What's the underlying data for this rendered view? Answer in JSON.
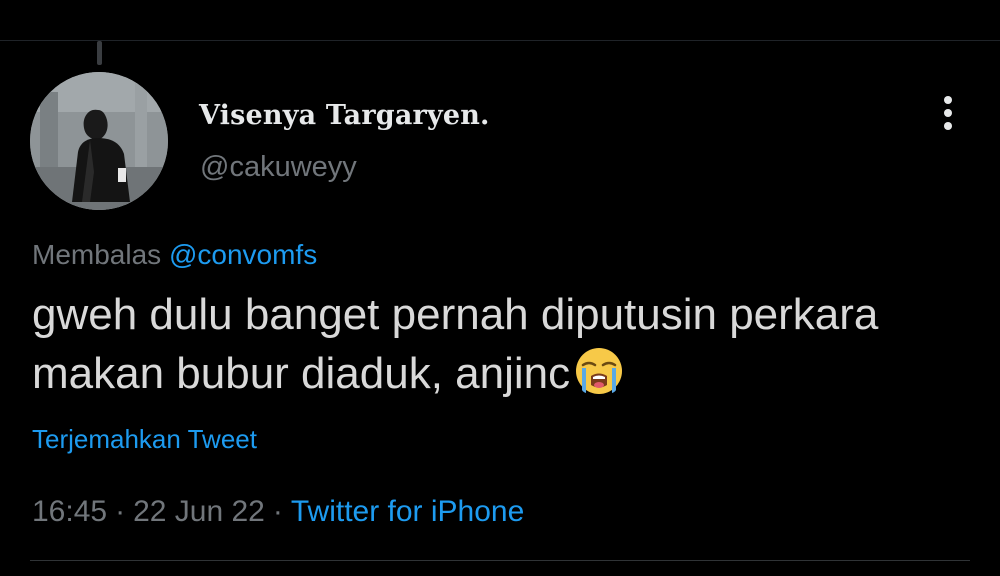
{
  "tweet": {
    "author": {
      "display_name": "Visenya Targaryen.",
      "handle": "@cakuweyy"
    },
    "reply": {
      "prefix": "Membalas",
      "mention": "@convomfs"
    },
    "text": "gweh dulu banget pernah diputusin perkara makan bubur diaduk, anjinc",
    "emoji": "loudly-crying-face",
    "translate_label": "Terjemahkan Tweet",
    "time": "16:45",
    "separator": "·",
    "date": "22 Jun 22",
    "source": "Twitter for iPhone"
  },
  "colors": {
    "background": "#000000",
    "link": "#1d9bf0",
    "muted": "#71767b",
    "text": "#d9d9d9"
  }
}
